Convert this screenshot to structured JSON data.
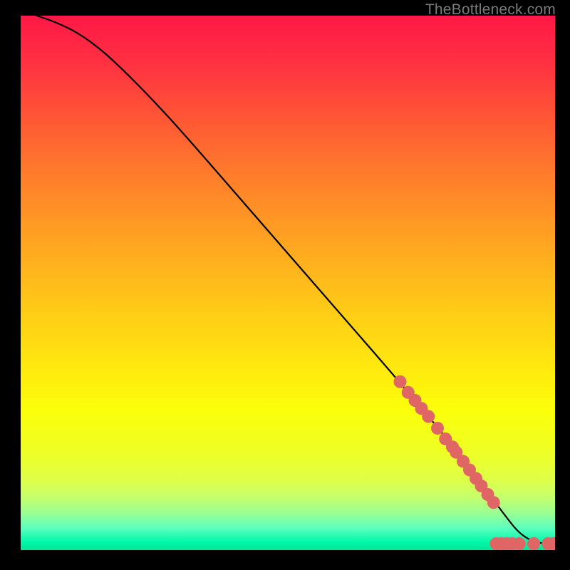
{
  "attribution": "TheBottleneck.com",
  "chart_data": {
    "type": "line",
    "title": "",
    "xlabel": "",
    "ylabel": "",
    "xlim": [
      0,
      100
    ],
    "ylim": [
      0,
      100
    ],
    "grid": false,
    "legend": false,
    "series": [
      {
        "name": "curve",
        "color": "#000000",
        "x": [
          3,
          6,
          10,
          14,
          18,
          24,
          30,
          40,
          50,
          60,
          70,
          78,
          84,
          88,
          91,
          93,
          95,
          97,
          100
        ],
        "y": [
          100,
          99,
          97.2,
          94.5,
          91,
          85,
          78.5,
          67,
          55.5,
          44,
          32.5,
          23,
          15.5,
          10,
          6,
          3.5,
          2,
          1.3,
          1.2
        ]
      }
    ],
    "markers": [
      {
        "name": "dots",
        "color": "#e06666",
        "radius": 9,
        "points": [
          {
            "x": 71.0,
            "y": 31.5
          },
          {
            "x": 72.5,
            "y": 29.5
          },
          {
            "x": 73.8,
            "y": 28.0
          },
          {
            "x": 75.0,
            "y": 26.5
          },
          {
            "x": 76.3,
            "y": 25.0
          },
          {
            "x": 78.0,
            "y": 22.8
          },
          {
            "x": 79.5,
            "y": 20.8
          },
          {
            "x": 80.8,
            "y": 19.3
          },
          {
            "x": 81.5,
            "y": 18.3
          },
          {
            "x": 82.8,
            "y": 16.6
          },
          {
            "x": 84.0,
            "y": 15.0
          },
          {
            "x": 85.2,
            "y": 13.4
          },
          {
            "x": 86.2,
            "y": 12.0
          },
          {
            "x": 87.4,
            "y": 10.4
          },
          {
            "x": 88.5,
            "y": 8.9
          },
          {
            "x": 89.0,
            "y": 1.2
          },
          {
            "x": 90.0,
            "y": 1.2
          },
          {
            "x": 91.0,
            "y": 1.2
          },
          {
            "x": 92.0,
            "y": 1.2
          },
          {
            "x": 93.3,
            "y": 1.2
          },
          {
            "x": 96.0,
            "y": 1.2
          },
          {
            "x": 98.7,
            "y": 1.2
          },
          {
            "x": 99.8,
            "y": 1.2
          }
        ]
      }
    ]
  }
}
